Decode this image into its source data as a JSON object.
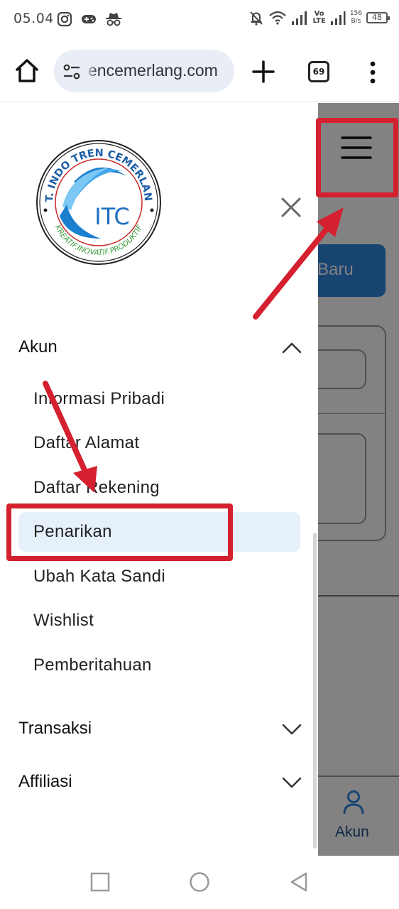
{
  "status_bar": {
    "time": "05.04",
    "net_speed_value": "156",
    "net_speed_unit": "B/s",
    "volte_top": "Vo",
    "volte_bottom": "LTE",
    "battery": "48",
    "icons": [
      "instagram-icon",
      "game-controller-icon",
      "incognito-icon",
      "notifications-off-icon",
      "wifi-icon",
      "signal-icon",
      "signal-2-icon",
      "battery-icon"
    ]
  },
  "browser": {
    "url_text": "encemerlang.com",
    "tab_count": "69",
    "icons": [
      "home-icon",
      "site-settings-icon",
      "plus-icon",
      "more-vert-icon"
    ]
  },
  "page_background": {
    "primary_button_label": "Baru",
    "bottom_nav_label": "Akun",
    "accent_color": "#2f86df"
  },
  "drawer": {
    "logo": {
      "top_text": "PT. INDO TREN CEMERLANG",
      "center_text": "ITC",
      "bottom_text": "KREATIF.INOVATIF.PRODUKTIF"
    },
    "sections": [
      {
        "label": "Akun",
        "expanded": true,
        "items": [
          {
            "label": "Informasi Pribadi"
          },
          {
            "label": "Daftar Alamat"
          },
          {
            "label": "Daftar Rekening"
          },
          {
            "label": "Penarikan",
            "active": true
          },
          {
            "label": "Ubah Kata Sandi"
          },
          {
            "label": "Wishlist"
          },
          {
            "label": "Pemberitahuan"
          }
        ]
      },
      {
        "label": "Transaksi",
        "expanded": false
      },
      {
        "label": "Affiliasi",
        "expanded": false
      }
    ],
    "active_color": "#e6f0fb"
  },
  "annotation_color": "#d4202f"
}
